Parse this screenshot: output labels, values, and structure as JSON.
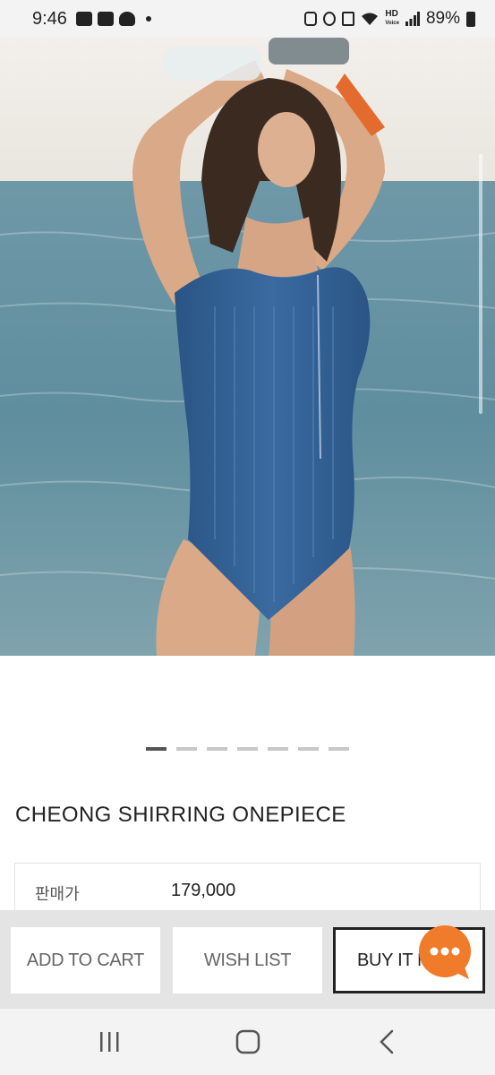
{
  "status_bar": {
    "time": "9:46",
    "hd_label": "HD",
    "hd_sub": "Voice",
    "battery_pct": "89%"
  },
  "gallery": {
    "slide_count": 7,
    "active_index": 0
  },
  "product": {
    "title": "CHEONG SHIRRING ONEPIECE",
    "price_label": "판매가",
    "price_value": "179,000"
  },
  "actions": {
    "add_to_cart": "ADD TO CART",
    "wish_list": "WISH LIST",
    "buy_it_now": "BUY IT N"
  },
  "colors": {
    "chat_accent": "#f07b2a",
    "swimsuit": "#2f5d8f"
  },
  "icons": {
    "chat": "chat-bubble-icon",
    "nav_recent": "recent-apps-icon",
    "nav_home": "home-icon",
    "nav_back": "back-icon"
  }
}
